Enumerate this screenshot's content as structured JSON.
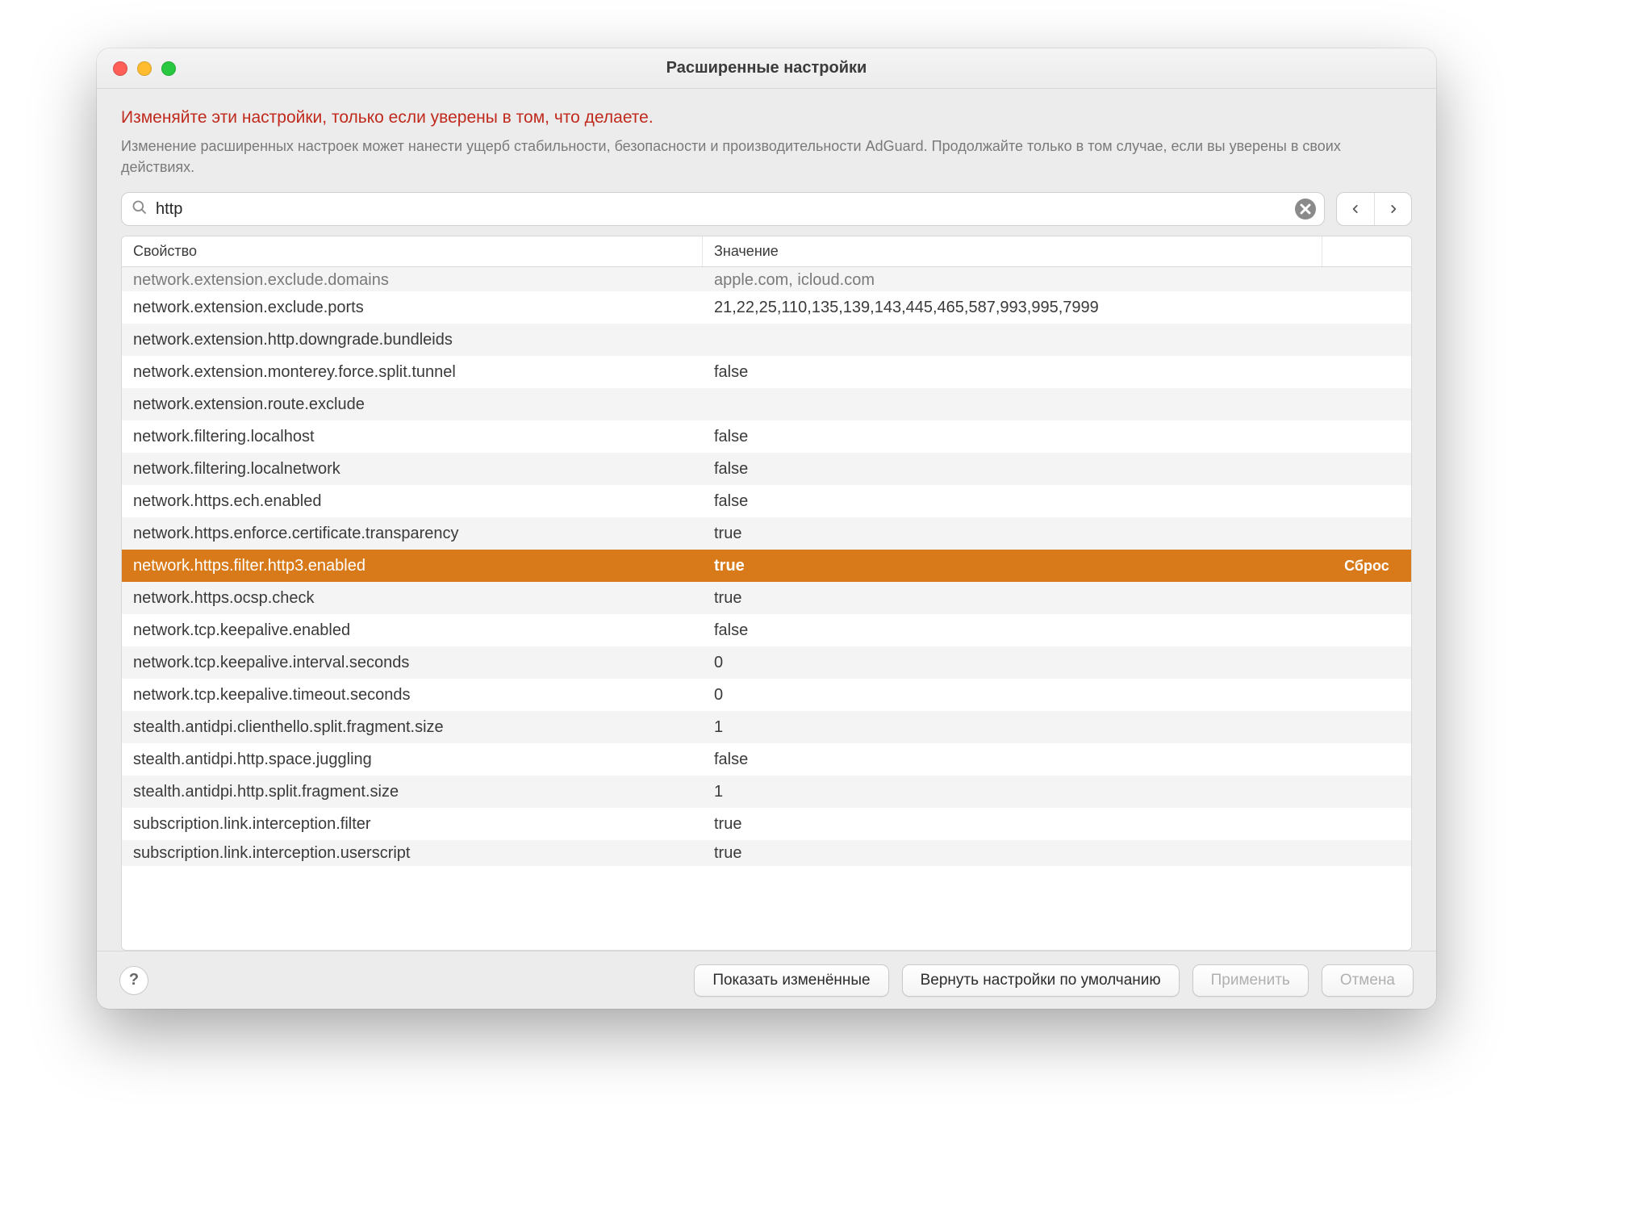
{
  "window": {
    "title": "Расширенные настройки"
  },
  "warning": {
    "title": "Изменяйте эти настройки, только если уверены в том, что делаете.",
    "subtitle": "Изменение расширенных настроек может нанести ущерб стабильности, безопасности и производительности AdGuard. Продолжайте только в том случае, если вы уверены в своих действиях."
  },
  "search": {
    "value": "http",
    "placeholder": ""
  },
  "table": {
    "col_property": "Свойство",
    "col_value": "Значение",
    "reset_label": "Сброс",
    "rows": [
      {
        "property": "network.extension.exclude.domains",
        "value": "apple.com, icloud.com",
        "cutoff_top": true
      },
      {
        "property": "network.extension.exclude.ports",
        "value": "21,22,25,110,135,139,143,445,465,587,993,995,7999"
      },
      {
        "property": "network.extension.http.downgrade.bundleids",
        "value": ""
      },
      {
        "property": "network.extension.monterey.force.split.tunnel",
        "value": "false"
      },
      {
        "property": "network.extension.route.exclude",
        "value": ""
      },
      {
        "property": "network.filtering.localhost",
        "value": "false"
      },
      {
        "property": "network.filtering.localnetwork",
        "value": "false"
      },
      {
        "property": "network.https.ech.enabled",
        "value": "false"
      },
      {
        "property": "network.https.enforce.certificate.transparency",
        "value": "true"
      },
      {
        "property": "network.https.filter.http3.enabled",
        "value": "true",
        "selected": true
      },
      {
        "property": "network.https.ocsp.check",
        "value": "true"
      },
      {
        "property": "network.tcp.keepalive.enabled",
        "value": "false"
      },
      {
        "property": "network.tcp.keepalive.interval.seconds",
        "value": "0"
      },
      {
        "property": "network.tcp.keepalive.timeout.seconds",
        "value": "0"
      },
      {
        "property": "stealth.antidpi.clienthello.split.fragment.size",
        "value": "1"
      },
      {
        "property": "stealth.antidpi.http.space.juggling",
        "value": "false"
      },
      {
        "property": "stealth.antidpi.http.split.fragment.size",
        "value": "1"
      },
      {
        "property": "subscription.link.interception.filter",
        "value": "true"
      },
      {
        "property": "subscription.link.interception.userscript",
        "value": "true",
        "cutoff_bot": true
      }
    ]
  },
  "footer": {
    "show_changed": "Показать изменённые",
    "reset_defaults": "Вернуть настройки по умолчанию",
    "apply": "Применить",
    "cancel": "Отмена"
  }
}
